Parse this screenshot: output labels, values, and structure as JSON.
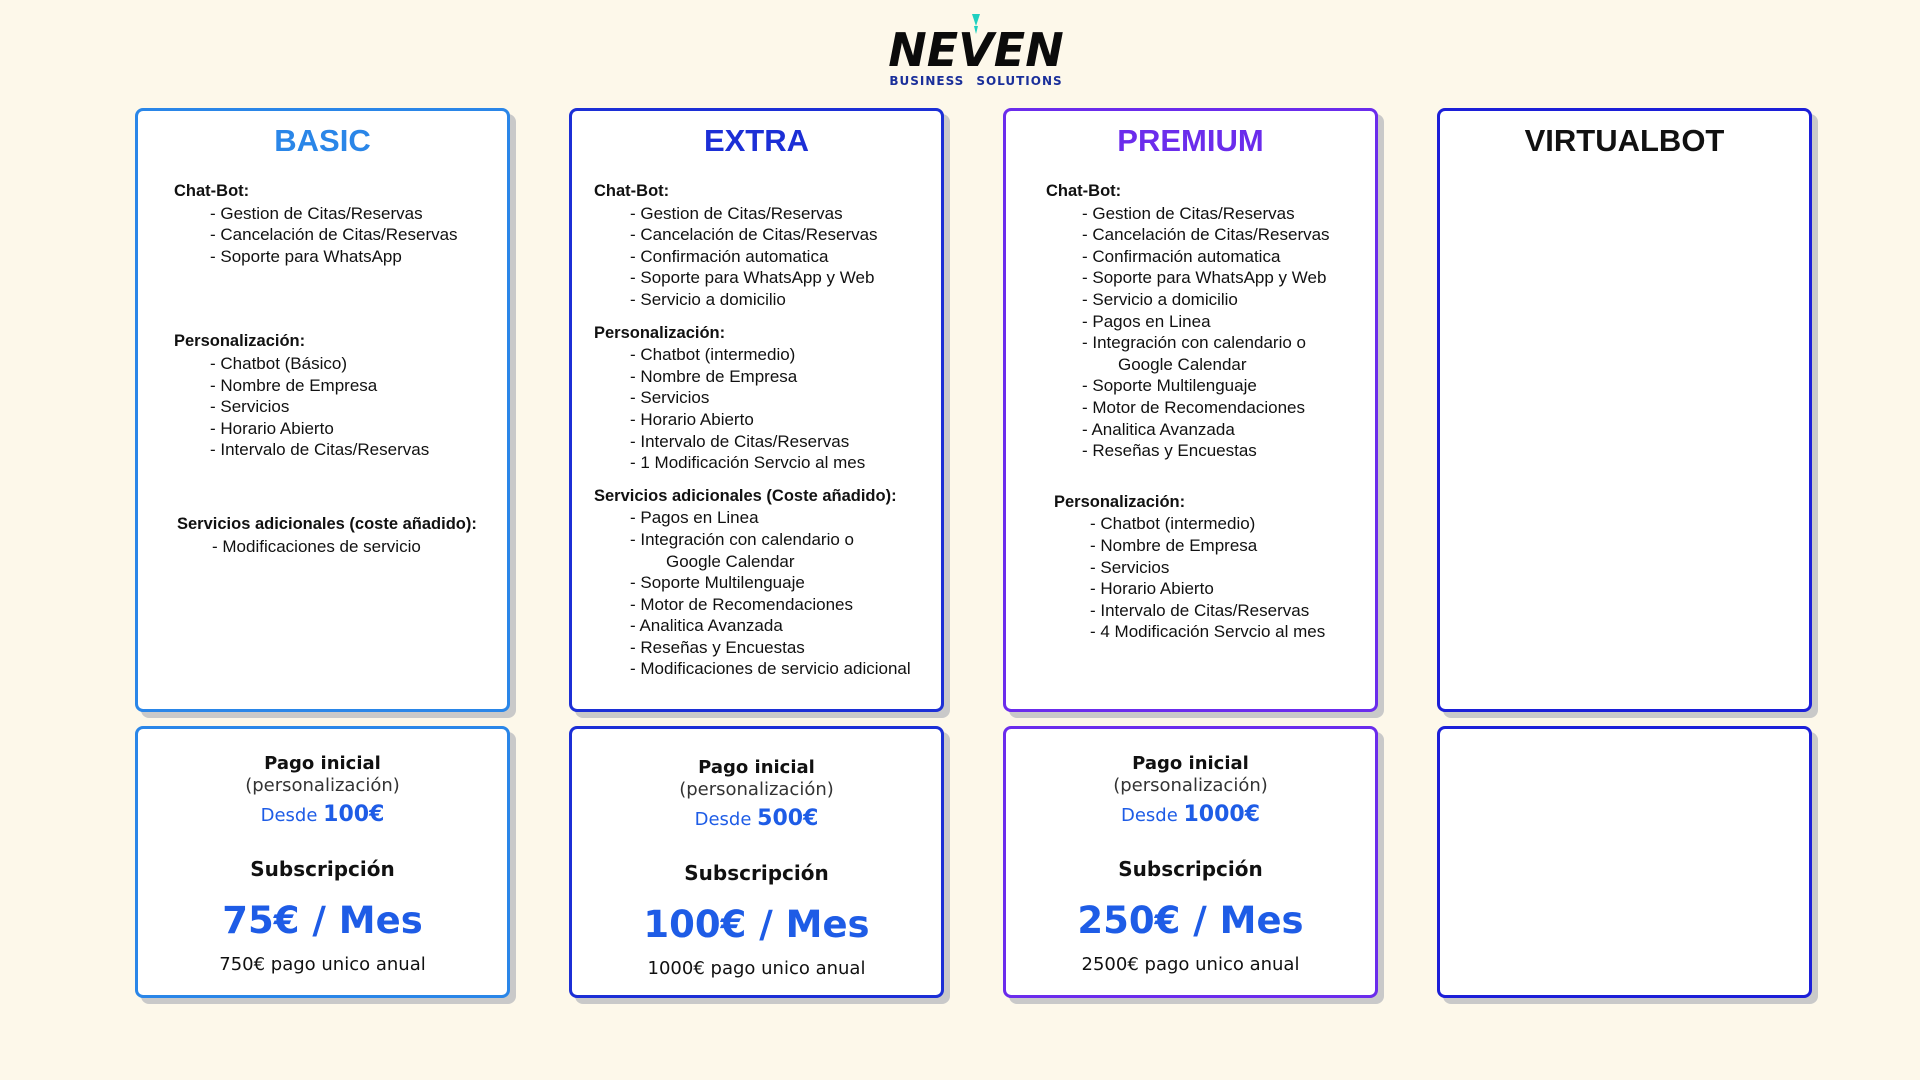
{
  "brand": {
    "logo_text": "NEVEN",
    "tagline_1": "BUSINESS",
    "tagline_2": "SOLUTIONS"
  },
  "plans": [
    {
      "name": "BASIC",
      "sections": [
        {
          "head": "Chat-Bot:",
          "items": [
            "- Gestion de Citas/Reservas",
            "- Cancelación de Citas/Reservas",
            "- Soporte para WhatsApp"
          ]
        },
        {
          "head": "Personalización:",
          "items": [
            "- Chatbot (Básico)",
            "- Nombre de Empresa",
            "- Servicios",
            "- Horario Abierto",
            "- Intervalo de Citas/Reservas"
          ]
        },
        {
          "head": "Servicios adicionales (coste añadido):",
          "items": [
            "- Modificaciones de servicio"
          ]
        }
      ],
      "pricing": {
        "initial_label": "Pago inicial",
        "initial_sub": "(personalización)",
        "desde": "Desde",
        "initial_price": "100€",
        "sub_label": "Subscripción",
        "sub_price": "75€ / Mes",
        "annual": "750€ pago unico anual"
      }
    },
    {
      "name": "EXTRA",
      "sections": [
        {
          "head": "Chat-Bot:",
          "items": [
            "- Gestion de Citas/Reservas",
            "- Cancelación de Citas/Reservas",
            "- Confirmación automatica",
            "- Soporte para WhatsApp y Web",
            "- Servicio a domicilio"
          ]
        },
        {
          "head": "Personalización:",
          "items": [
            "- Chatbot (intermedio)",
            "- Nombre de Empresa",
            "- Servicios",
            "- Horario Abierto",
            "- Intervalo de Citas/Reservas",
            "- 1 Modificación Servcio al mes"
          ]
        },
        {
          "head": "Servicios adicionales (Coste añadido):",
          "items": [
            "- Pagos en Linea",
            "- Integración con calendario o",
            "Google Calendar",
            "- Soporte Multilenguaje",
            "- Motor de Recomendaciones",
            "- Analitica Avanzada",
            "- Reseñas y Encuestas",
            "- Modificaciones de servicio adicional"
          ]
        }
      ],
      "pricing": {
        "initial_label": "Pago inicial",
        "initial_sub": "(personalización)",
        "desde": "Desde",
        "initial_price": "500€",
        "sub_label": "Subscripción",
        "sub_price": "100€ / Mes",
        "annual": "1000€ pago unico anual"
      }
    },
    {
      "name": "PREMIUM",
      "sections": [
        {
          "head": "Chat-Bot:",
          "items": [
            "- Gestion de Citas/Reservas",
            "- Cancelación de Citas/Reservas",
            "- Confirmación automatica",
            "- Soporte para WhatsApp y Web",
            "- Servicio a domicilio",
            "- Pagos en Linea",
            "- Integración con calendario o",
            "Google Calendar",
            "- Soporte Multilenguaje",
            "- Motor de Recomendaciones",
            "- Analitica Avanzada",
            "- Reseñas y Encuestas"
          ]
        },
        {
          "head": "Personalización:",
          "items": [
            "- Chatbot (intermedio)",
            "- Nombre de Empresa",
            "- Servicios",
            "- Horario Abierto",
            "- Intervalo de Citas/Reservas",
            "- 4 Modificación Servcio al mes"
          ]
        }
      ],
      "pricing": {
        "initial_label": "Pago inicial",
        "initial_sub": "(personalización)",
        "desde": "Desde",
        "initial_price": "1000€",
        "sub_label": "Subscripción",
        "sub_price": "250€ / Mes",
        "annual": "2500€ pago unico anual"
      }
    },
    {
      "name": "VIRTUALBOT"
    }
  ],
  "colors": {
    "background": "#fdf8ea",
    "basic": "#2a86e8",
    "extra": "#1c2fd6",
    "premium": "#6b2cec",
    "price_blue": "#1e5ce6"
  }
}
